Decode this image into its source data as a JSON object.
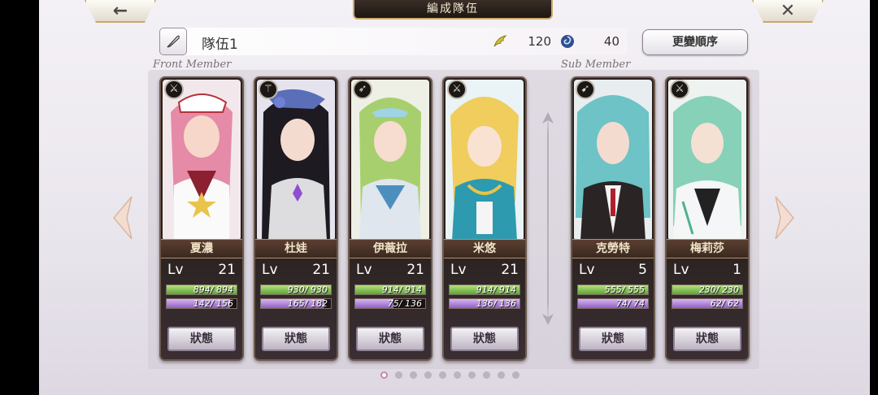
{
  "header": {
    "title": "編成隊伍",
    "back_icon": "←",
    "close_icon": "✕"
  },
  "team": {
    "name": "隊伍1",
    "stat1_value": "120",
    "stat2_value": "40",
    "reorder_label": "更變順序"
  },
  "sections": {
    "front_label": "Front Member",
    "sub_label": "Sub Member"
  },
  "status_label": "狀態",
  "level_label": "Lv",
  "members": [
    {
      "name": "夏濃",
      "level": "21",
      "hp": "894/ 894",
      "hp_frac": 1.0,
      "mp": "142/ 156",
      "mp_frac": 0.91,
      "class_icon": "sword-icon",
      "class_glyph": "⚔"
    },
    {
      "name": "杜娃",
      "level": "21",
      "hp": "930/ 930",
      "hp_frac": 1.0,
      "mp": "165/ 182",
      "mp_frac": 0.91,
      "class_icon": "staff-icon",
      "class_glyph": "⚚"
    },
    {
      "name": "伊薇拉",
      "level": "21",
      "hp": "914/ 914",
      "hp_frac": 1.0,
      "mp": "75/ 136",
      "mp_frac": 0.55,
      "class_icon": "spear-icon",
      "class_glyph": "➶"
    },
    {
      "name": "米悠",
      "level": "21",
      "hp": "914/ 914",
      "hp_frac": 1.0,
      "mp": "136/ 136",
      "mp_frac": 1.0,
      "class_icon": "sword-icon",
      "class_glyph": "⚔"
    },
    {
      "name": "克勞特",
      "level": "5",
      "hp": "555/ 555",
      "hp_frac": 1.0,
      "mp": "74/ 74",
      "mp_frac": 1.0,
      "class_icon": "bow-icon",
      "class_glyph": "➹"
    },
    {
      "name": "梅莉莎",
      "level": "1",
      "hp": "230/ 230",
      "hp_frac": 1.0,
      "mp": "62/ 62",
      "mp_frac": 1.0,
      "class_icon": "sword-icon",
      "class_glyph": "⚔"
    }
  ],
  "pagination": {
    "total": 10,
    "active": 1
  },
  "colors": {
    "hp_bar": "#5da43a",
    "mp_bar": "#8f5fc4",
    "accent_gold": "#c9a86b",
    "frame_bg": "#2b1f1d"
  }
}
